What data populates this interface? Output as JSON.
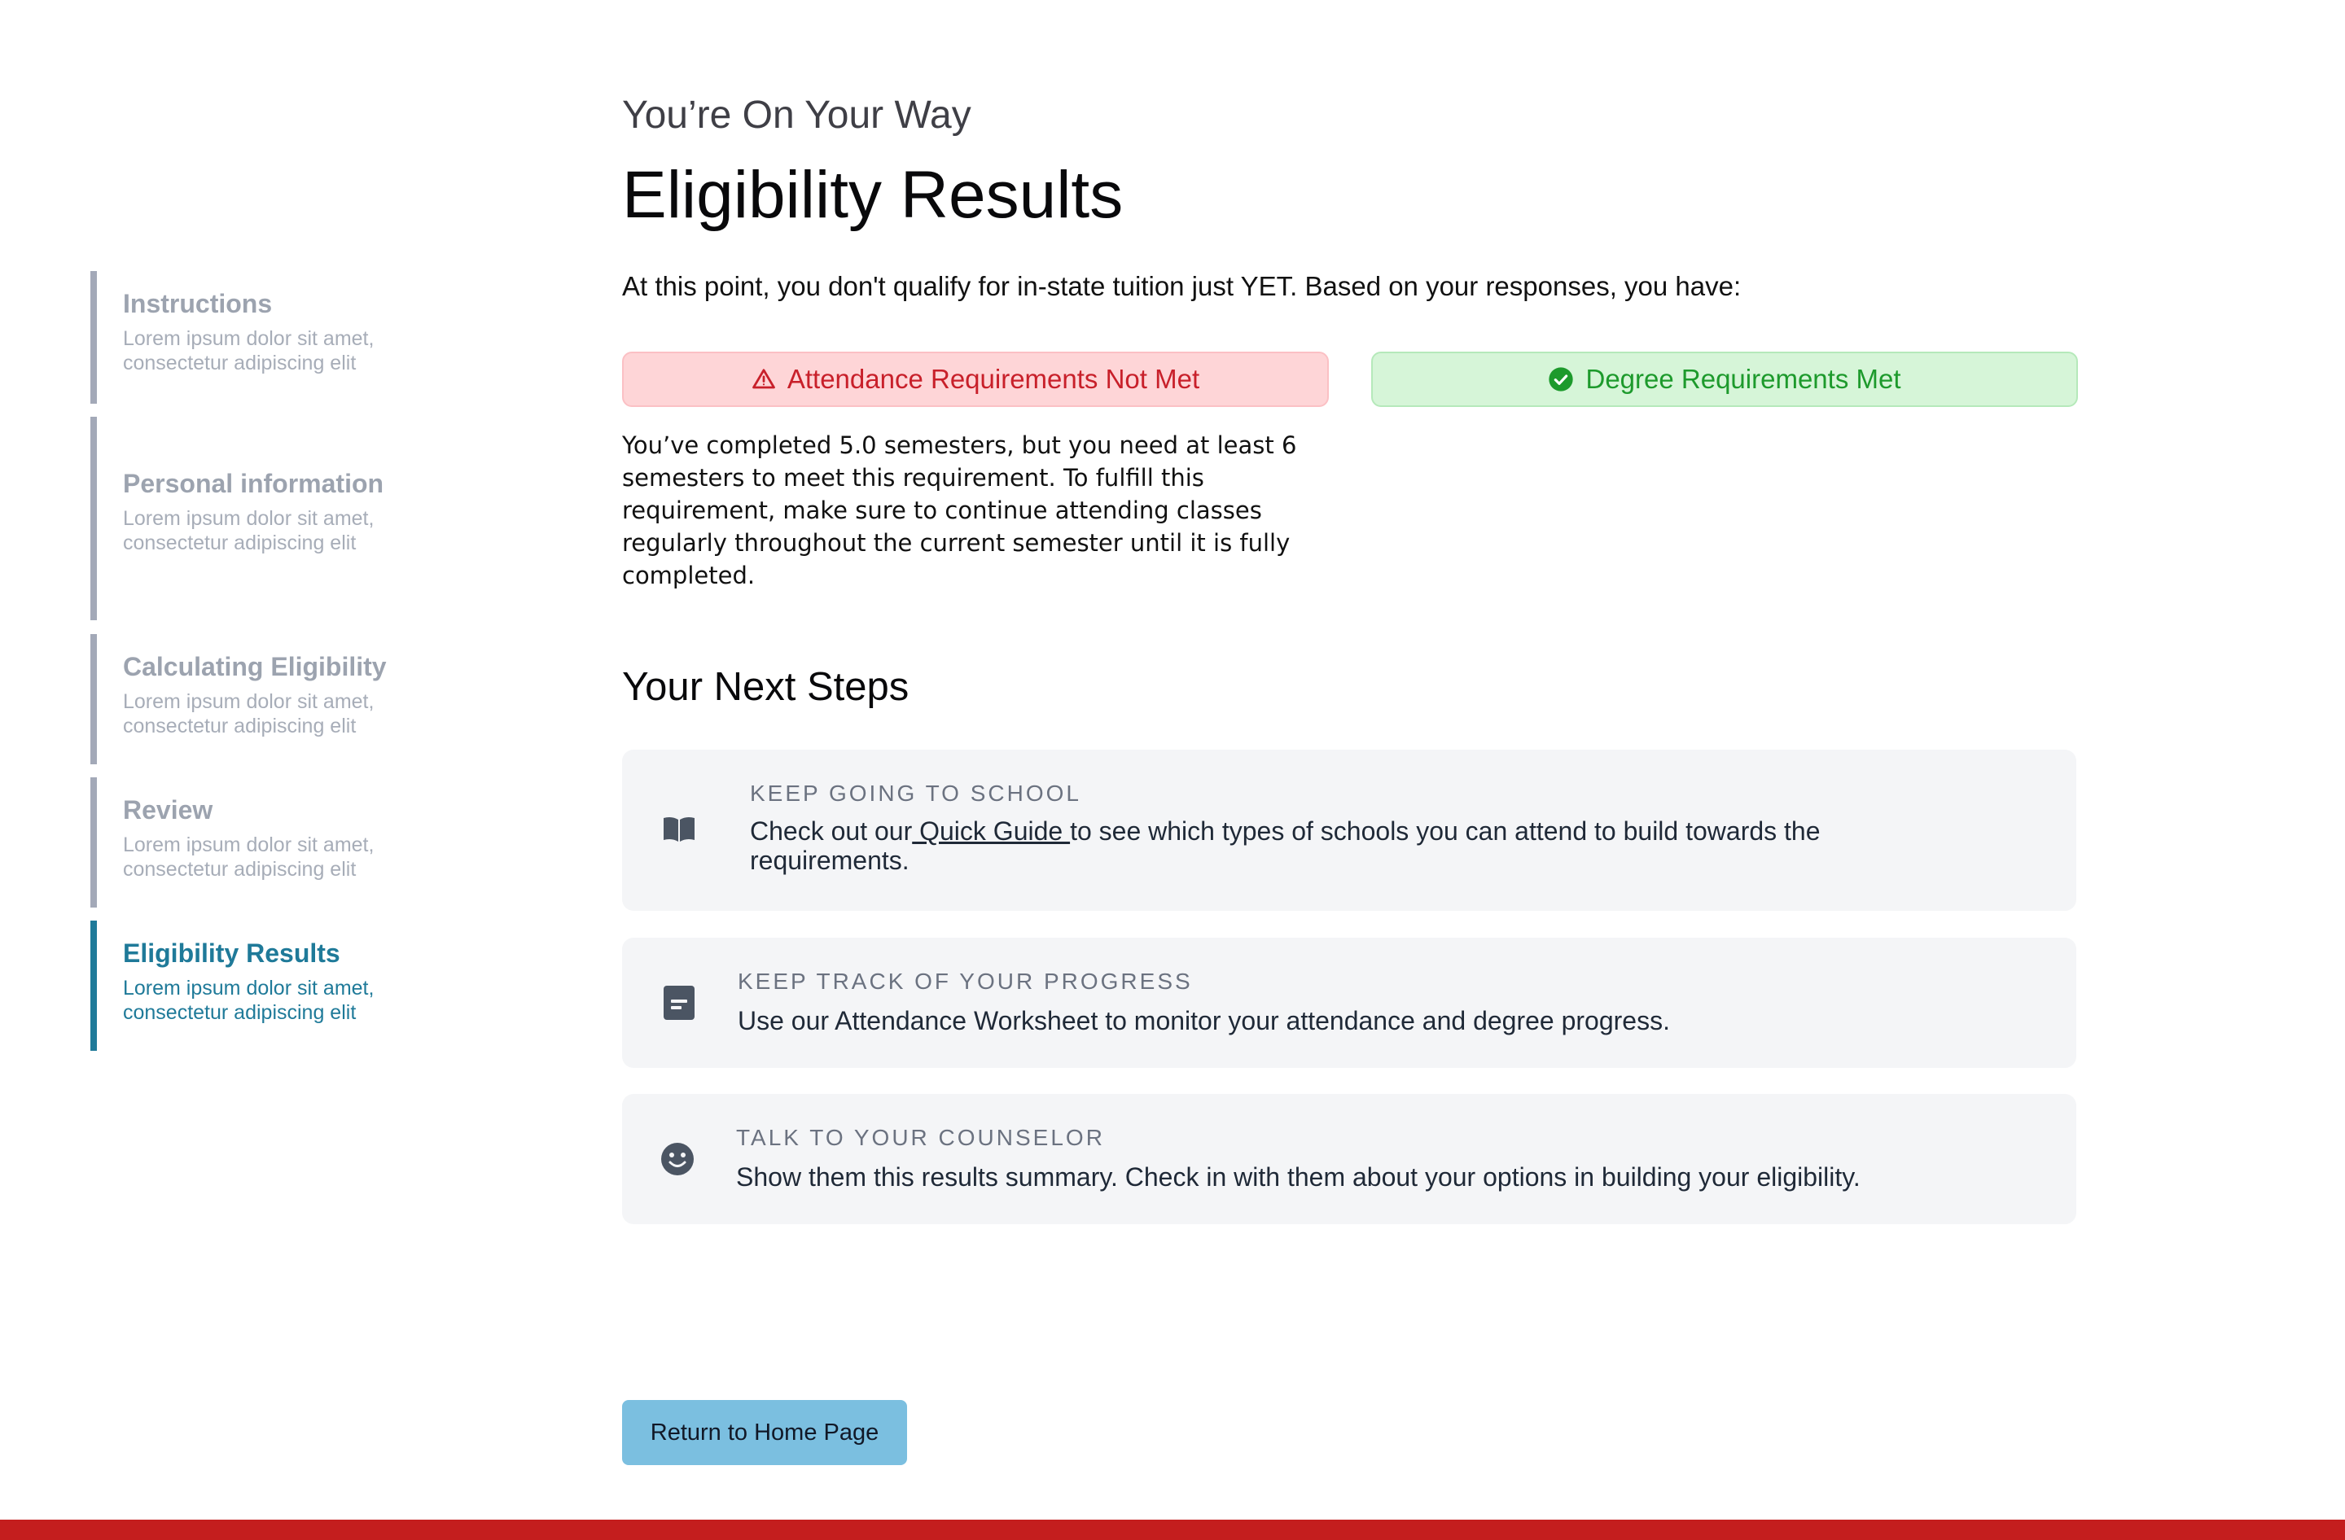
{
  "sidebar": {
    "steps": [
      {
        "title": "Instructions",
        "description": "Lorem ipsum dolor sit amet, consectetur adipiscing elit"
      },
      {
        "title": "Personal information",
        "description": "Lorem ipsum dolor sit amet, consectetur adipiscing elit"
      },
      {
        "title": "Calculating Eligibility",
        "description": "Lorem ipsum dolor sit amet, consectetur adipiscing elit"
      },
      {
        "title": "Review",
        "description": "Lorem ipsum dolor sit amet, consectetur adipiscing elit"
      },
      {
        "title": "Eligibility Results",
        "description": "Lorem ipsum dolor sit amet, consectetur adipiscing elit"
      }
    ],
    "active_step": "Eligibility Results"
  },
  "header": {
    "subtitle": "You’re On Your Way",
    "title": "Eligibility Results"
  },
  "intro": "At this point, you don't qualify for in-state tuition just YET. Based on your responses, you have:",
  "results": {
    "attendance": {
      "label": "Attendance Requirements Not Met",
      "status": "not-met",
      "icon": "warning-triangle-icon",
      "detail": "You’ve completed 5.0 semesters, but you need at least 6 semesters to meet this requirement. To fulfill this requirement, make sure to continue attending classes regularly throughout the current semester until it is fully completed."
    },
    "degree": {
      "label": "Degree Requirements Met",
      "status": "met",
      "icon": "check-circle-icon"
    }
  },
  "next_steps": {
    "title": "Your Next Steps",
    "items": [
      {
        "icon": "book-icon",
        "heading": "KEEP GOING TO SCHOOL",
        "text_before": "Check out our",
        "link": " Quick Guide ",
        "text_after": "to see which types of schools you can attend to build towards the requirements."
      },
      {
        "icon": "document-icon",
        "heading": "KEEP TRACK OF YOUR PROGRESS",
        "text": "Use our Attendance Worksheet to monitor your attendance and degree progress."
      },
      {
        "icon": "smiley-icon",
        "heading": "TALK TO YOUR COUNSELOR",
        "text": "Show them this results summary. Check in with them about your options in building your eligibility."
      }
    ]
  },
  "actions": {
    "home_button": "Return to Home Page"
  },
  "colors": {
    "accent": "#1f7a99",
    "error_bg": "#fed5d7",
    "error_text": "#c8202a",
    "success_bg": "#d6f5d8",
    "success_text": "#1d9a2c",
    "button_bg": "#7bbfe0",
    "footer_bar": "#c41e1e"
  }
}
